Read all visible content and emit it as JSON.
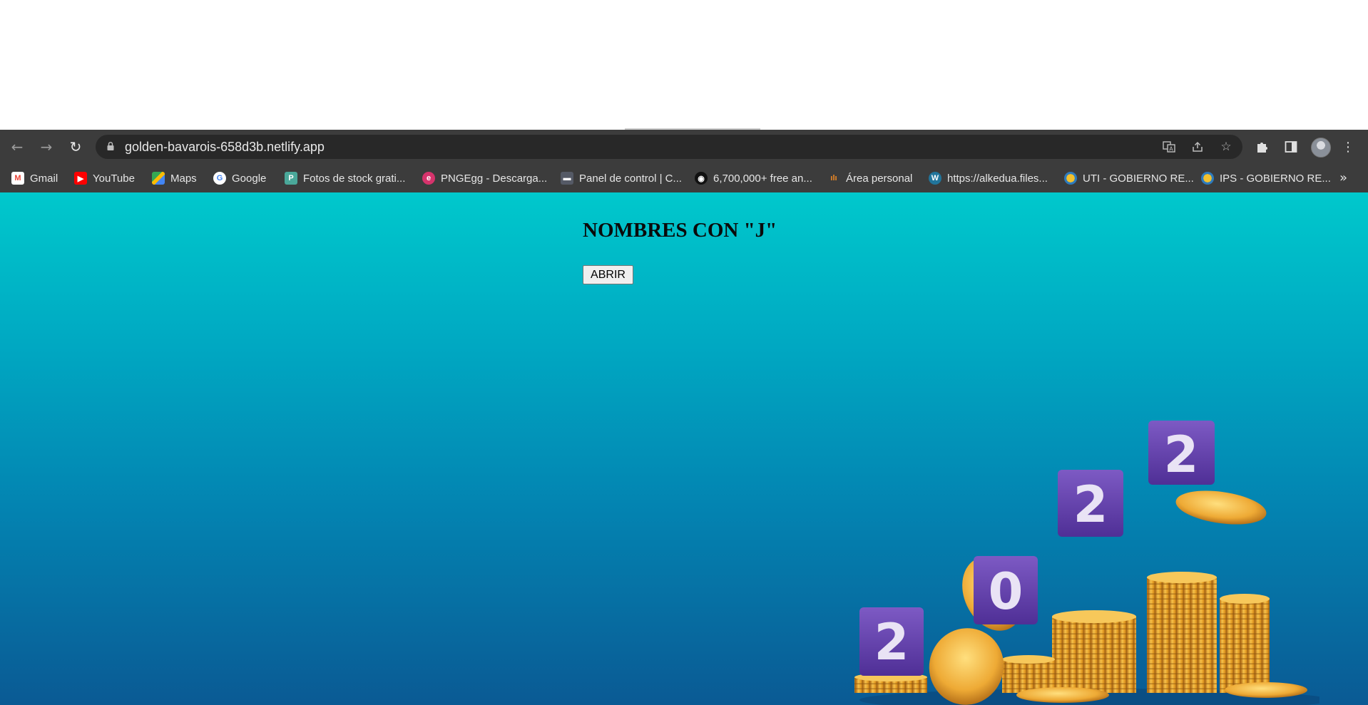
{
  "browser": {
    "url": "golden-bavarois-658d3b.netlify.app",
    "bookmarks": [
      {
        "label": "Gmail",
        "icon": "gmail-icon"
      },
      {
        "label": "YouTube",
        "icon": "youtube-icon"
      },
      {
        "label": "Maps",
        "icon": "maps-icon"
      },
      {
        "label": "Google",
        "icon": "google-icon"
      },
      {
        "label": "Fotos de stock grati...",
        "icon": "stock-photos-icon"
      },
      {
        "label": "PNGEgg - Descarga...",
        "icon": "pngegg-icon"
      },
      {
        "label": "Panel de control | C...",
        "icon": "panel-icon"
      },
      {
        "label": "6,700,000+ free an...",
        "icon": "free-assets-icon"
      },
      {
        "label": "Área personal",
        "icon": "personal-area-icon"
      },
      {
        "label": "https://alkedua.files...",
        "icon": "wordpress-icon"
      },
      {
        "label": "UTI - GOBIERNO RE...",
        "icon": "gobierno-icon"
      },
      {
        "label": "IPS - GOBIERNO RE...",
        "icon": "gobierno-icon"
      }
    ]
  },
  "page": {
    "heading": "NOMBRES CON \"J\"",
    "button_label": "ABRIR",
    "coin_block_digits": [
      "2",
      "0",
      "2",
      "2"
    ]
  },
  "colors": {
    "page_gradient_top": "#00c8cc",
    "page_gradient_bottom": "#0a5a94",
    "toolbar": "#3c3c3c",
    "coin_gold": "#e8a52c",
    "block_purple": "#6d49b3"
  }
}
